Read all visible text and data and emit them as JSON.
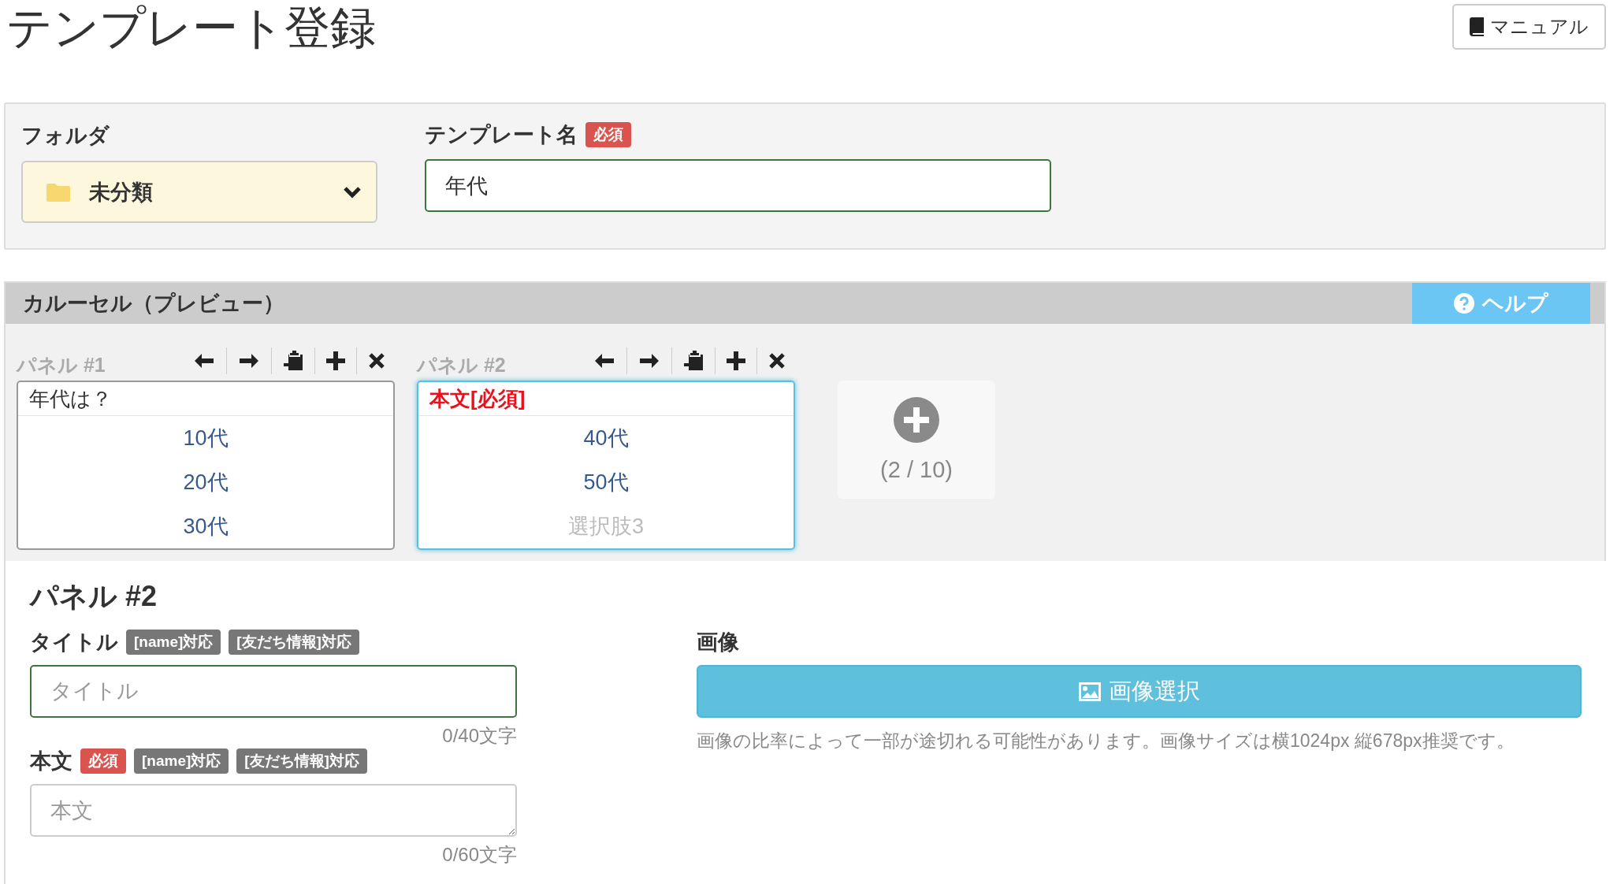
{
  "page": {
    "title": "テンプレート登録",
    "manual_button": "マニュアル"
  },
  "settings": {
    "folder_label": "フォルダ",
    "folder_value": "未分類",
    "name_label": "テンプレート名",
    "name_badge": "必須",
    "name_value": "年代",
    "name_valid": true
  },
  "carousel": {
    "title": "カルーセル（プレビュー）",
    "help_button": "ヘルプ",
    "add_counter": "(2 / 10)",
    "panels": [
      {
        "label": "パネル #1",
        "selected": false,
        "title": "年代は？",
        "title_required": false,
        "options": [
          {
            "text": "10代",
            "kind": "value"
          },
          {
            "text": "20代",
            "kind": "value"
          },
          {
            "text": "30代",
            "kind": "value"
          }
        ]
      },
      {
        "label": "パネル #2",
        "selected": true,
        "title": "本文[必須]",
        "title_required": true,
        "options": [
          {
            "text": "40代",
            "kind": "value"
          },
          {
            "text": "50代",
            "kind": "value"
          },
          {
            "text": "選択肢3",
            "kind": "placeholder"
          }
        ]
      }
    ]
  },
  "editor": {
    "heading": "パネル #2",
    "fields": [
      {
        "kind": "input",
        "label": "タイトル",
        "valid": true,
        "badges": [
          {
            "text": "[name]対応",
            "kind": "info"
          },
          {
            "text": "[友だち情報]対応",
            "kind": "info"
          }
        ],
        "placeholder": "タイトル",
        "counter": "0/40文字"
      },
      {
        "kind": "textarea",
        "label": "本文",
        "valid": false,
        "badges": [
          {
            "text": "必須",
            "kind": "required"
          },
          {
            "text": "[name]対応",
            "kind": "info"
          },
          {
            "text": "[友だち情報]対応",
            "kind": "info"
          }
        ],
        "placeholder": "本文",
        "counter": "0/60文字"
      }
    ],
    "image": {
      "label": "画像",
      "button": "画像選択",
      "note": "画像の比率によって一部が途切れる可能性があります。画像サイズは横1024px 縦678px推奨です。"
    }
  }
}
